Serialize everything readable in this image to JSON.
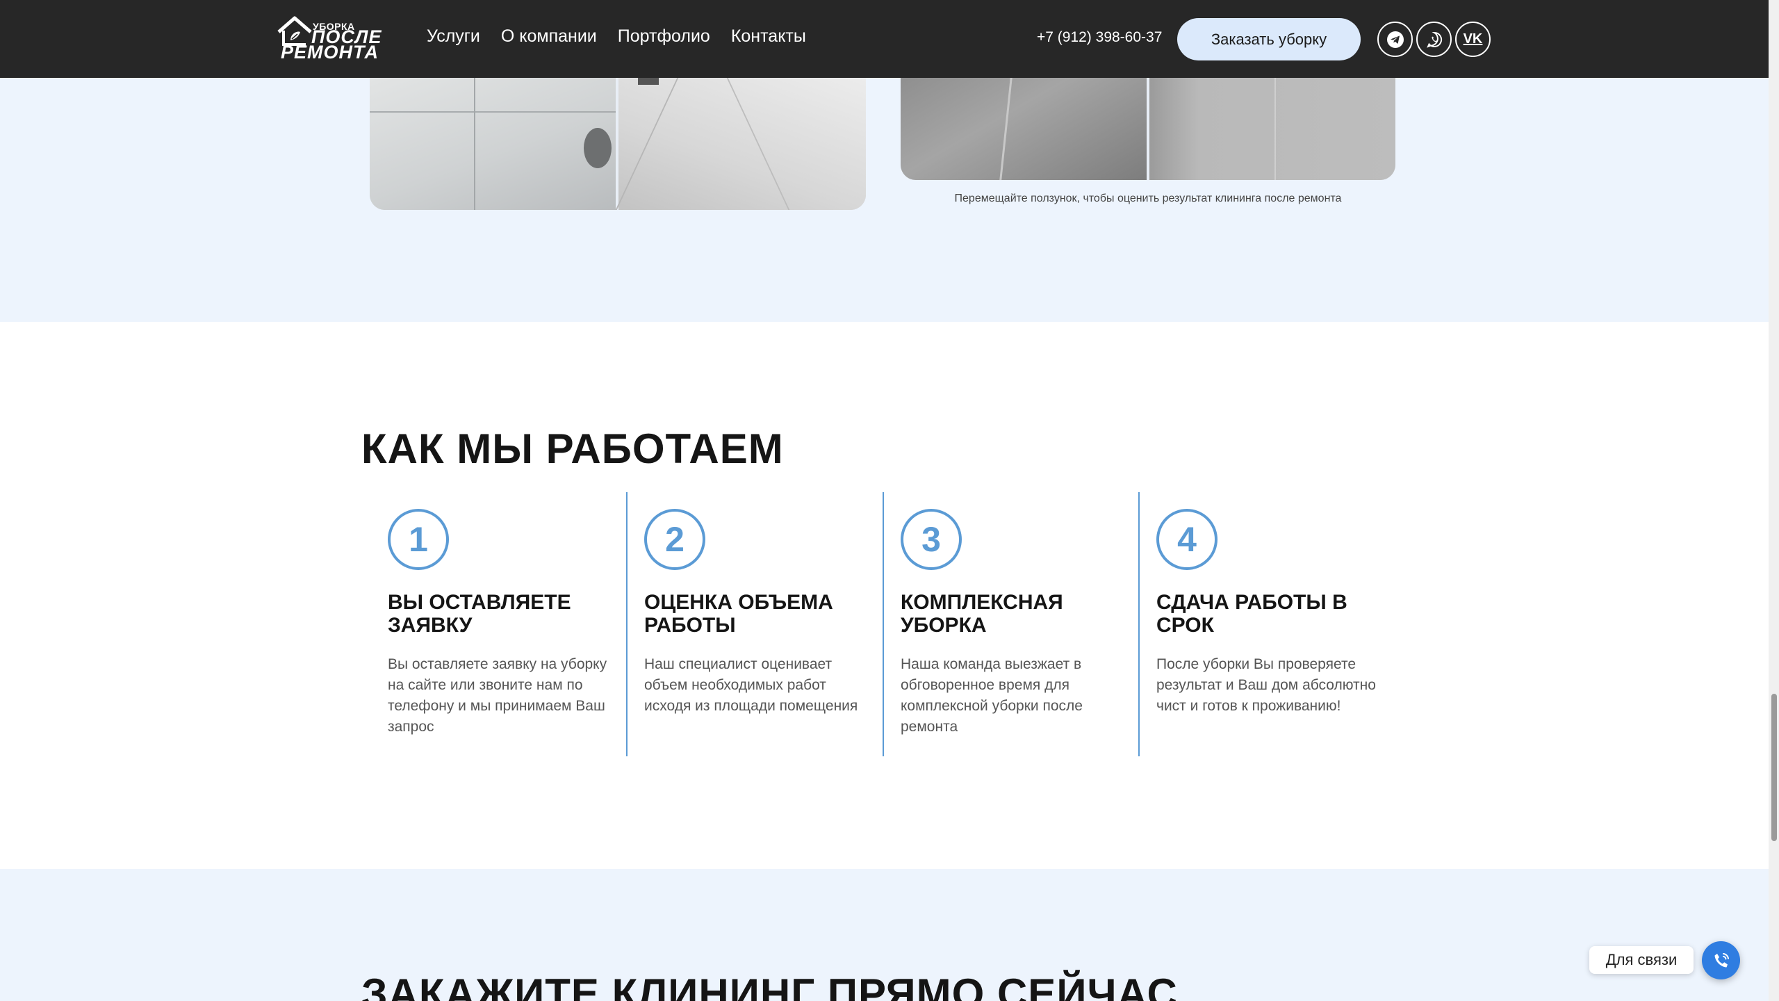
{
  "header": {
    "logo": {
      "line_small": "УБОРКА",
      "line_big_1": "ПОСЛЕ",
      "line_big_2": "РЕМОНТА"
    },
    "nav": [
      "Услуги",
      "О компании",
      "Портфолио",
      "Контакты"
    ],
    "phone": "+7 (912) 398-60-37",
    "order_button": "Заказать уборку",
    "socials": [
      "telegram-icon",
      "whatsapp-icon",
      "vk-icon"
    ],
    "vk_label": "VK"
  },
  "before_after": {
    "hint": "Перемещайте ползунок, чтобы оценить результат клининга после ремонта",
    "slider_positions": [
      0.5,
      0.5
    ]
  },
  "how_we_work": {
    "title": "КАК МЫ РАБОТАЕМ",
    "steps": [
      {
        "number": "1",
        "title": "ВЫ ОСТАВЛЯЕТЕ ЗАЯВКУ",
        "text": "Вы оставляете заявку на уборку на сайте или звоните нам по телефону и мы принимаем Ваш запрос"
      },
      {
        "number": "2",
        "title": "ОЦЕНКА ОБЪЕМА РАБОТЫ",
        "text": "Наш специалист оценивает объем необходимых работ исходя из площади помещения"
      },
      {
        "number": "3",
        "title": "КОМПЛЕКСНАЯ УБОРКА",
        "text": "Наша команда выезжает в обговоренное время для комплексной уборки после ремонта"
      },
      {
        "number": "4",
        "title": "СДАЧА РАБОТЫ В СРОК",
        "text": "После уборки Вы проверяете результат и Ваш дом абсолютно чист и готов к проживанию!"
      }
    ]
  },
  "order_section": {
    "title": "ЗАКАЖИТЕ КЛИНИНГ ПРЯМО СЕЙЧАС"
  },
  "contact_widget": {
    "label": "Для связи",
    "icon": "phone-ring-icon"
  },
  "colors": {
    "header_bg": "#272727",
    "accent": "#5b9bd5",
    "light_band": "#edf4fd",
    "button_bg": "#dbe9fb",
    "widget_blue": "#2f7de1"
  }
}
